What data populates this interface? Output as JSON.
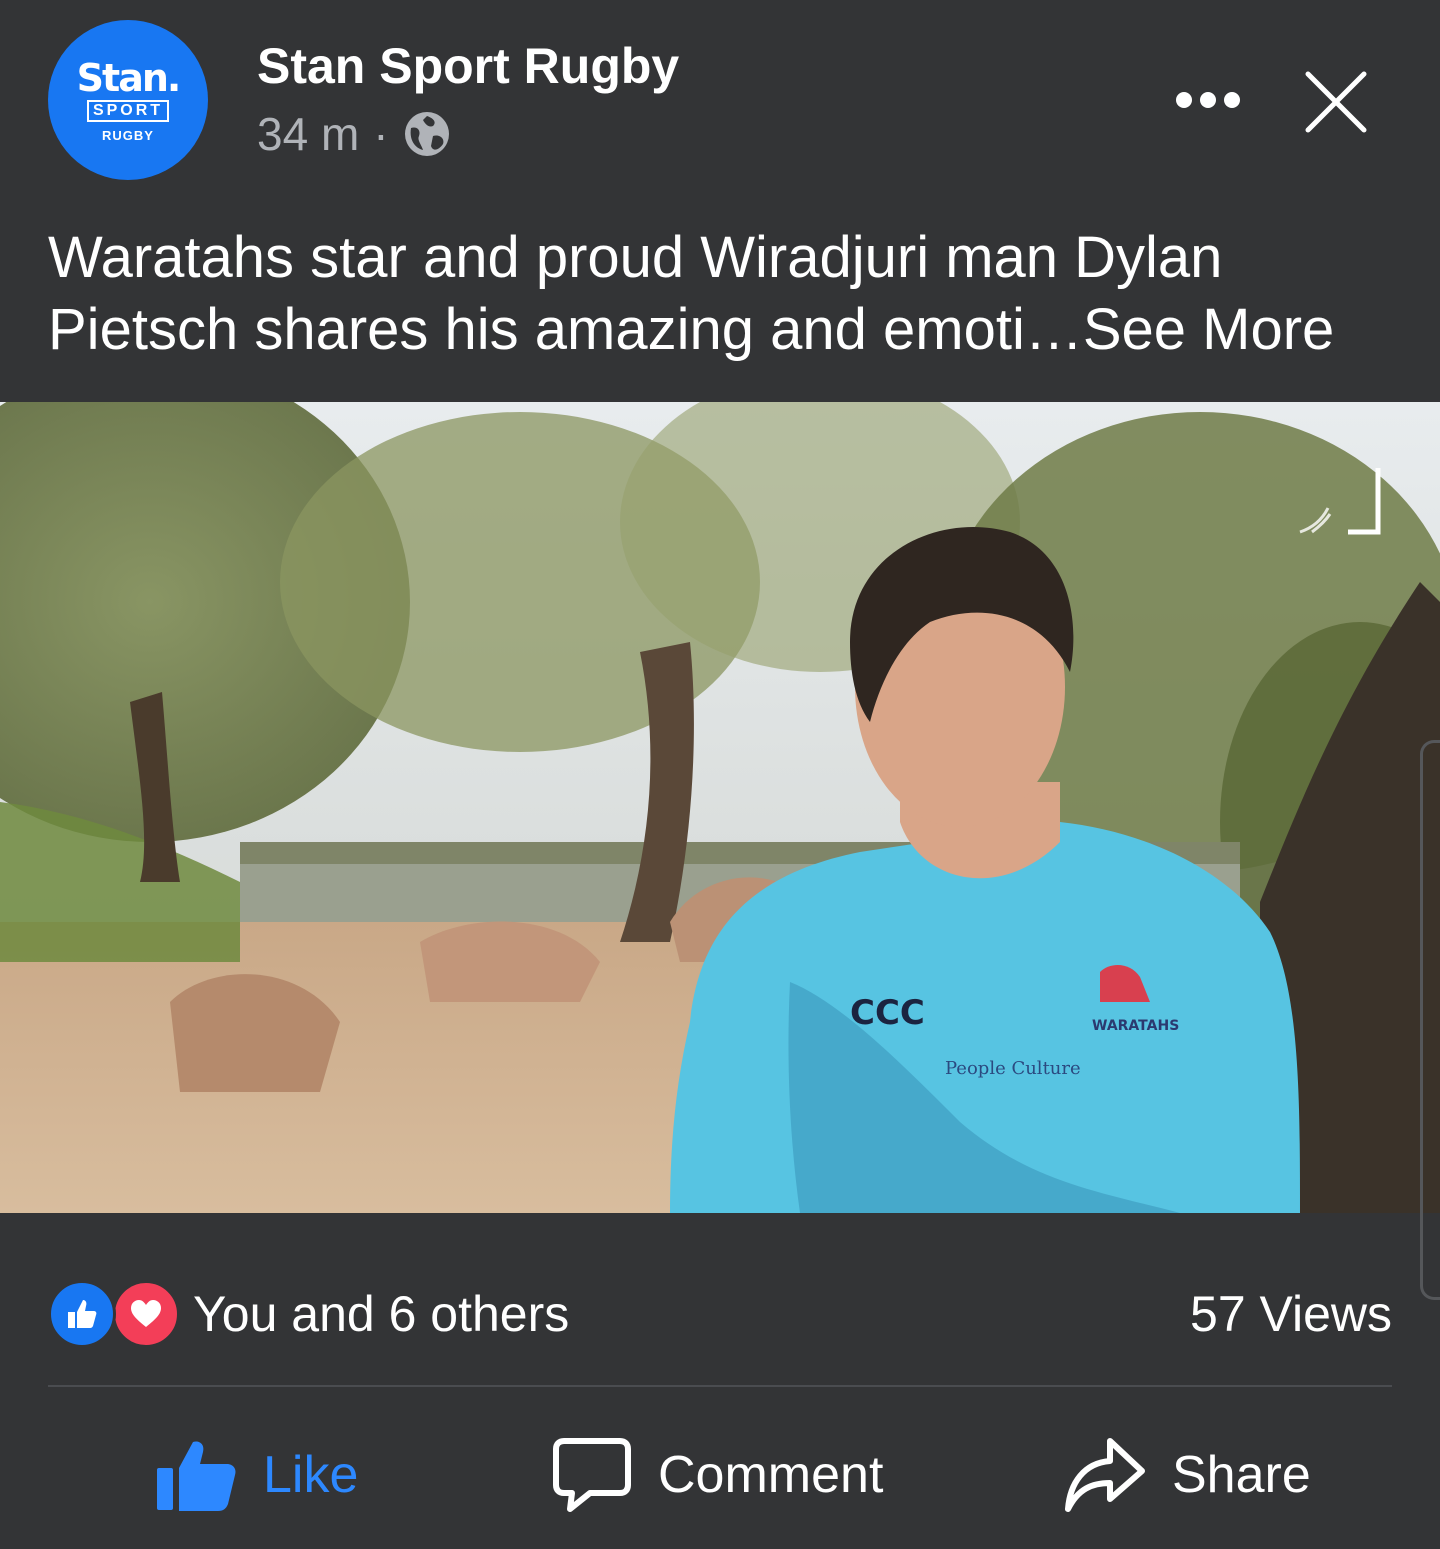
{
  "post": {
    "avatar": {
      "brand": "Stan.",
      "sport": "SPORT",
      "sub": "RUGBY"
    },
    "page_name": "Stan Sport Rugby",
    "time": "34 m",
    "separator": "·",
    "privacy_icon": "globe-icon",
    "caption": "Waratahs star and proud Wiradjuri man Dylan Pietsch shares his amazing and emoti…",
    "see_more": "See More"
  },
  "toolbar": {
    "more_icon": "more-horizontal-icon",
    "close_icon": "close-icon"
  },
  "video": {
    "fullscreen_icon": "fullscreen-icon"
  },
  "reactions": {
    "icons": [
      "like-reaction-icon",
      "love-reaction-icon"
    ],
    "text": "You and 6 others",
    "views": "57 Views"
  },
  "actions": {
    "like": "Like",
    "comment": "Comment",
    "share": "Share"
  },
  "colors": {
    "background": "#333436",
    "accent": "#1877f2",
    "like_active": "#2d88ff",
    "love": "#f33e58",
    "secondary_text": "#b0b3b8"
  }
}
